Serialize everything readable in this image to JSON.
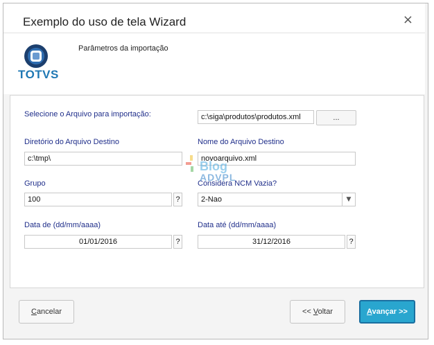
{
  "window": {
    "title": "Exemplo do uso de tela Wizard",
    "close_symbol": "×"
  },
  "header": {
    "logo_text": "TOTVS",
    "subtitle": "Parâmetros da importação"
  },
  "form": {
    "arquivo_label": "Selecione o Arquivo para importação:",
    "arquivo_value": "c:\\siga\\produtos\\produtos.xml",
    "browse_label": "...",
    "diretorio_label": "Diretório do Arquivo Destino",
    "diretorio_value": "c:\\tmp\\",
    "nome_label": "Nome do Arquivo Destino",
    "nome_value": "novoarquivo.xml",
    "grupo_label": "Grupo",
    "grupo_value": "100",
    "ncm_label": "Considera NCM Vazia?",
    "ncm_value": "2-Nao",
    "data_de_label": "Data de (dd/mm/aaaa)",
    "data_de_value": "01/01/2016",
    "data_ate_label": "Data até (dd/mm/aaaa)",
    "data_ate_value": "31/12/2016",
    "help_symbol": "?"
  },
  "watermark": {
    "line1": "Blog",
    "line2": "ADVPL"
  },
  "footer": {
    "cancel_first": "C",
    "cancel_rest": "ancelar",
    "back_prefix": "<< ",
    "back_first": "V",
    "back_rest": "oltar",
    "next_first": "A",
    "next_rest": "vançar >>"
  },
  "colors": {
    "label_blue": "#1f2e8a",
    "primary_button": "#29a6cf",
    "logo_blue": "#1f78b4"
  },
  "icons": [
    "totvs-logo-icon",
    "close-icon",
    "dropdown-arrow-icon"
  ]
}
